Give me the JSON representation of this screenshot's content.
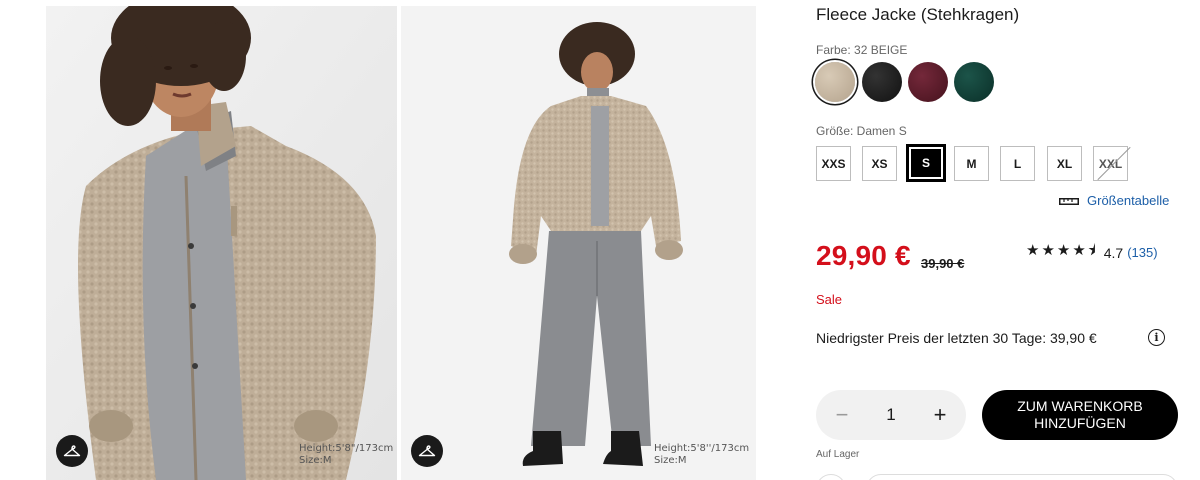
{
  "gallery": {
    "images": [
      {
        "model_info": [
          "Height:5'8\"/173cm",
          "Size:M"
        ]
      },
      {
        "model_info": [
          "Height:5'8''/173cm",
          "Size:M"
        ]
      }
    ],
    "hanger_icon": "hanger-icon"
  },
  "product": {
    "title": "Fleece Jacke (Stehkragen)",
    "color_label": "Farbe: 32 BEIGE",
    "colors": [
      {
        "name": "beige",
        "hex": "#c8b8a4",
        "selected": true
      },
      {
        "name": "black",
        "hex": "#1c1c1c",
        "selected": false
      },
      {
        "name": "wine",
        "hex": "#5a1a26",
        "selected": false
      },
      {
        "name": "green",
        "hex": "#0f3f36",
        "selected": false
      }
    ],
    "size_label": "Größe: Damen S",
    "sizes": [
      {
        "label": "XXS",
        "state": "available"
      },
      {
        "label": "XS",
        "state": "available"
      },
      {
        "label": "S",
        "state": "selected"
      },
      {
        "label": "M",
        "state": "available"
      },
      {
        "label": "L",
        "state": "available"
      },
      {
        "label": "XL",
        "state": "available"
      },
      {
        "label": "XXL",
        "state": "unavailable"
      }
    ],
    "size_chart_label": "Größentabelle",
    "size_chart_icon": "ruler-icon",
    "price": "29,90 €",
    "old_price": "39,90 €",
    "rating": {
      "stars": "★★★★⯨",
      "value": "4.7",
      "count": "(135)",
      "score": 4.7
    },
    "sale_label": "Sale",
    "lowest_price_text": "Niedrigster Preis der letzten 30 Tage: 39,90 €",
    "info_icon": "i",
    "quantity": {
      "minus": "−",
      "value": "1",
      "plus": "+"
    },
    "add_to_cart": "ZUM WARENKORB HINZUFÜGEN",
    "stock": "Auf Lager"
  },
  "colors": {
    "price_red": "#d40f1b",
    "link_blue": "#1d5fa8",
    "button_black": "#000000"
  }
}
